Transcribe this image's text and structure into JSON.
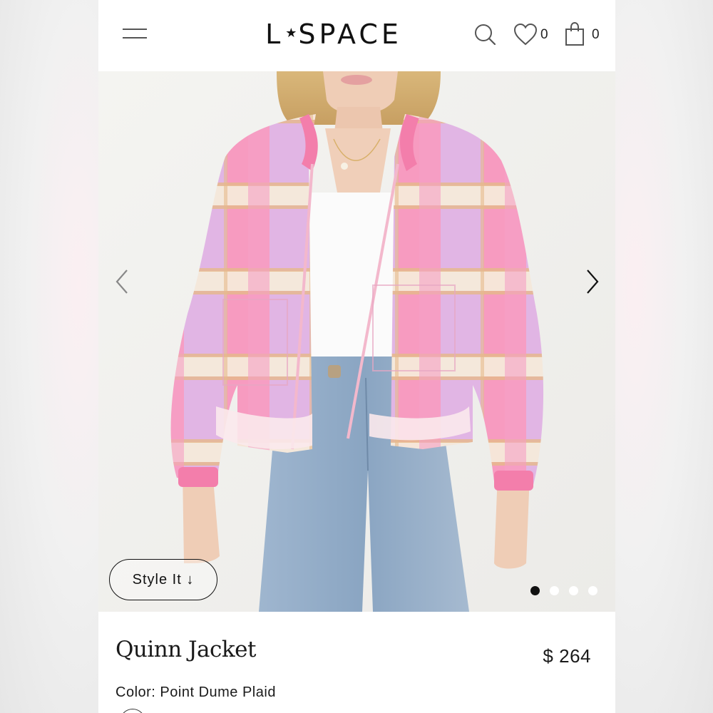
{
  "brand": {
    "logo_left": "L",
    "logo_star": "★",
    "logo_right": "SPACE"
  },
  "header": {
    "icons": [
      "menu-icon",
      "search-icon",
      "heart-icon",
      "shopping-bag-icon"
    ],
    "wishlist_count": "0",
    "cart_count": "0"
  },
  "gallery": {
    "style_it_label": "Style It ↓",
    "slide_count": 4,
    "active_slide": 1
  },
  "product": {
    "name": "Quinn Jacket",
    "price": "$ 264",
    "color_label": "Color:",
    "color_value": "Point Dume Plaid"
  },
  "colors": {
    "jacket_pink": "#f58fb4",
    "jacket_lavender": "#cdb4ec",
    "jacket_cream": "#f6ecd6",
    "denim": "#8fa9c6",
    "text": "#111111"
  }
}
